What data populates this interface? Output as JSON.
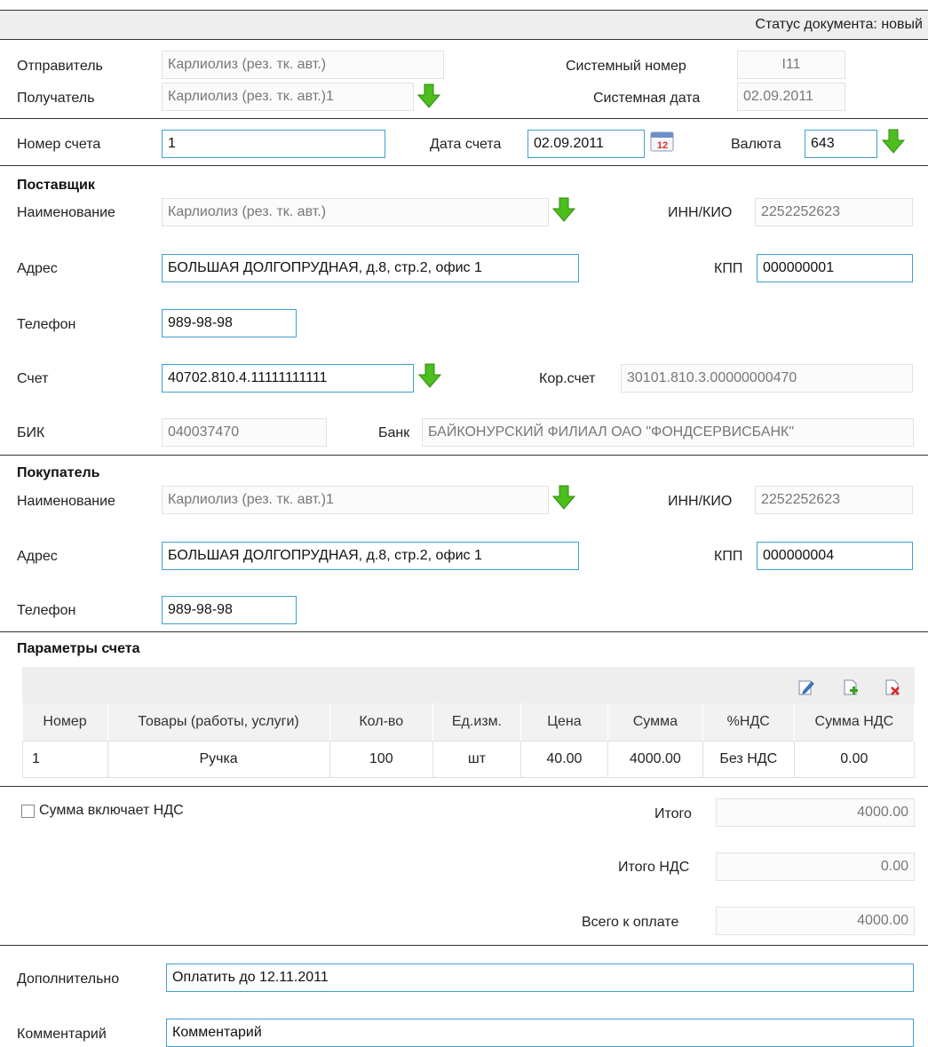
{
  "status": {
    "text": "Статус документа: новый"
  },
  "header": {
    "sender_label": "Отправитель",
    "sender_value": "Карлиолиз (рез. тк. авт.)",
    "receiver_label": "Получатель",
    "receiver_value": "Карлиолиз (рез. тк. авт.)1",
    "sysnum_label": "Системный номер",
    "sysnum_value": "I11",
    "sysdate_label": "Системная дата",
    "sysdate_value": "02.09.2011"
  },
  "invoice": {
    "number_label": "Номер счета",
    "number_value": "1",
    "date_label": "Дата счета",
    "date_value": "02.09.2011",
    "currency_label": "Валюта",
    "currency_value": "643"
  },
  "supplier": {
    "section_title": "Поставщик",
    "name_label": "Наименование",
    "name_value": "Карлиолиз (рез. тк. авт.)",
    "inn_label": "ИНН/КИО",
    "inn_value": "2252252623",
    "address_label": "Адрес",
    "address_value": "БОЛЬШАЯ ДОЛГОПРУДНАЯ, д.8, стр.2, офис 1",
    "kpp_label": "КПП",
    "kpp_value": "000000001",
    "phone_label": "Телефон",
    "phone_value": "989-98-98",
    "account_label": "Счет",
    "account_value": "40702.810.4.11111111111",
    "coracc_label": "Кор.счет",
    "coracc_value": "30101.810.3.00000000470",
    "bik_label": "БИК",
    "bik_value": "040037470",
    "bank_label": "Банк",
    "bank_value": "БАЙКОНУРСКИЙ ФИЛИАЛ ОАО \"ФОНДСЕРВИСБАНК\""
  },
  "buyer": {
    "section_title": "Покупатель",
    "name_label": "Наименование",
    "name_value": "Карлиолиз (рез. тк. авт.)1",
    "inn_label": "ИНН/КИО",
    "inn_value": "2252252623",
    "address_label": "Адрес",
    "address_value": "БОЛЬШАЯ ДОЛГОПРУДНАЯ, д.8, стр.2, офис 1",
    "kpp_label": "КПП",
    "kpp_value": "000000004",
    "phone_label": "Телефон",
    "phone_value": "989-98-98"
  },
  "params": {
    "section_title": "Параметры счета",
    "columns": [
      "Номер",
      "Товары (работы, услуги)",
      "Кол-во",
      "Ед.изм.",
      "Цена",
      "Сумма",
      "%НДС",
      "Сумма НДС"
    ],
    "rows": [
      [
        "1",
        "Ручка",
        "100",
        "шт",
        "40.00",
        "4000.00",
        "Без НДС",
        "0.00"
      ]
    ]
  },
  "totals": {
    "vat_included_label": "Сумма включает НДС",
    "total_label": "Итого",
    "total_value": "4000.00",
    "total_vat_label": "Итого НДС",
    "total_vat_value": "0.00",
    "grand_total_label": "Всего к оплате",
    "grand_total_value": "4000.00"
  },
  "extra": {
    "additional_label": "Дополнительно",
    "additional_value": "Оплатить до 12.11.2011",
    "comment_label": "Комментарий",
    "comment_value": "Комментарий"
  },
  "colors": {
    "accent_border": "#3f9fd1",
    "arrow_green": "#4cbf1e"
  }
}
